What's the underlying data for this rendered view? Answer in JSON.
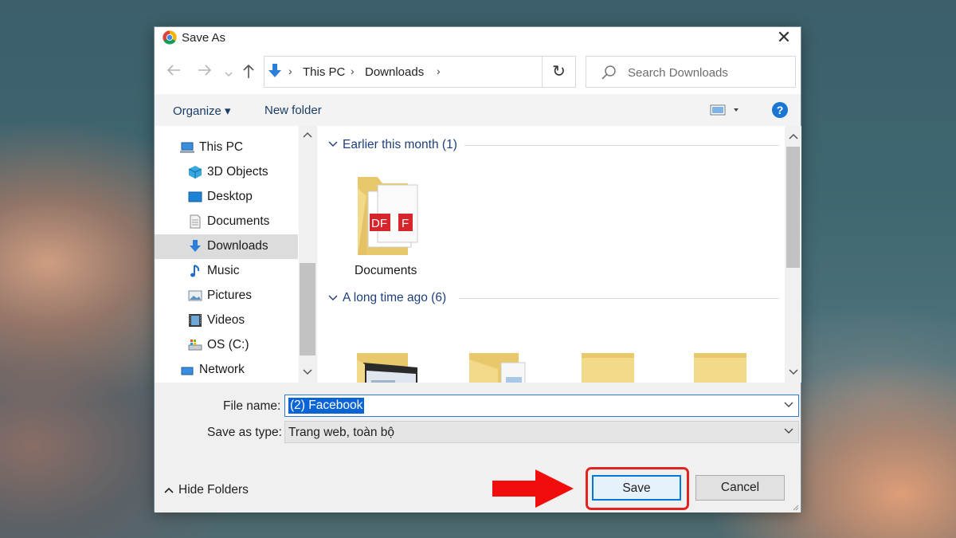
{
  "window": {
    "title": "Save As"
  },
  "nav": {
    "back_icon": "arrow-left-icon",
    "forward_icon": "arrow-right-icon",
    "recent_icon": "chevron-down-icon",
    "up_icon": "arrow-up-icon"
  },
  "address": {
    "crumbs": [
      "This PC",
      "Downloads"
    ]
  },
  "search": {
    "placeholder": "Search Downloads"
  },
  "toolbar": {
    "organize_label": "Organize",
    "new_folder_label": "New folder",
    "help_label": "?"
  },
  "sidebar": {
    "items": [
      {
        "label": "This PC",
        "icon": "computer-icon"
      },
      {
        "label": "3D Objects",
        "icon": "cube-icon"
      },
      {
        "label": "Desktop",
        "icon": "desktop-icon"
      },
      {
        "label": "Documents",
        "icon": "document-icon"
      },
      {
        "label": "Downloads",
        "icon": "download-icon",
        "selected": true
      },
      {
        "label": "Music",
        "icon": "music-note-icon"
      },
      {
        "label": "Pictures",
        "icon": "picture-icon"
      },
      {
        "label": "Videos",
        "icon": "film-icon"
      },
      {
        "label": "OS (C:)",
        "icon": "drive-icon"
      },
      {
        "label": "Network",
        "icon": "network-icon"
      }
    ]
  },
  "groups": [
    {
      "header": "Earlier this month (1)",
      "items": [
        {
          "name": "Documents"
        }
      ]
    },
    {
      "header": "A long time ago (6)"
    }
  ],
  "form": {
    "file_name_label": "File name:",
    "file_name_value": "(2) Facebook",
    "save_type_label": "Save as type:",
    "save_type_value": "Trang web, toàn bộ"
  },
  "footer": {
    "hide_folders_label": "Hide Folders",
    "save_label": "Save",
    "cancel_label": "Cancel"
  },
  "colors": {
    "highlight": "#e32222",
    "accent": "#0078d7",
    "selection": "#0a64d6",
    "group_header": "#1e3f7a"
  }
}
